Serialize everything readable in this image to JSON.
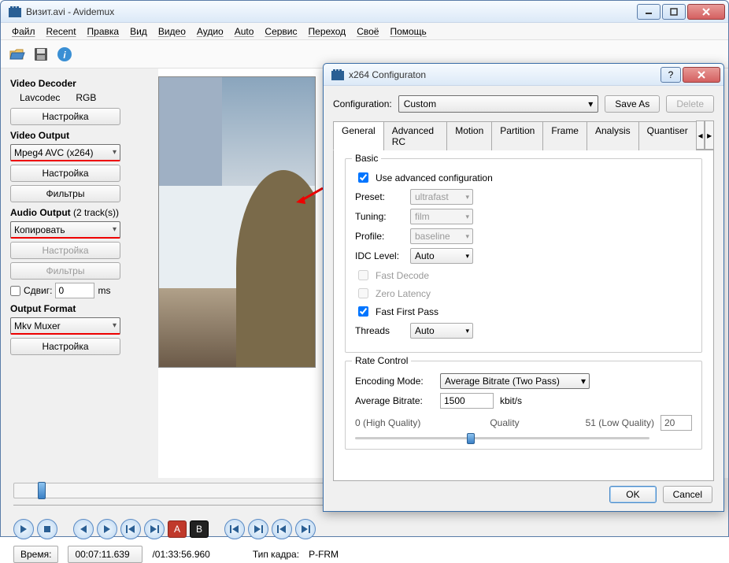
{
  "window": {
    "title": "Визит.avi - Avidemux"
  },
  "menu": [
    "Файл",
    "Recent",
    "Правка",
    "Вид",
    "Видео",
    "Аудио",
    "Auto",
    "Сервис",
    "Переход",
    "Своё",
    "Помощь"
  ],
  "sidebar": {
    "videoDecoder": {
      "title": "Video Decoder",
      "lav": "Lavcodec",
      "rgb": "RGB",
      "config": "Настройка"
    },
    "videoOutput": {
      "title": "Video Output",
      "codec": "Mpeg4 AVC (x264)",
      "config": "Настройка",
      "filters": "Фильтры"
    },
    "audioOutput": {
      "title": "Audio Output",
      "tracks": "(2 track(s))",
      "copy": "Копировать",
      "config": "Настройка",
      "filters": "Фильтры",
      "shift": "Сдвиг:",
      "shiftVal": "0",
      "shiftUnit": "ms"
    },
    "outputFormat": {
      "title": "Output Format",
      "muxer": "Mkv Muxer",
      "config": "Настройка"
    }
  },
  "status": {
    "timeLabel": "Время:",
    "time": "00:07:11.639",
    "total": "/01:33:56.960",
    "frameTypeLabel": "Тип кадра:",
    "frameType": "P-FRM"
  },
  "dialog": {
    "title": "x264 Configuraton",
    "configLabel": "Configuration:",
    "configValue": "Custom",
    "saveAs": "Save As",
    "delete": "Delete",
    "tabs": [
      "General",
      "Advanced RC",
      "Motion",
      "Partition",
      "Frame",
      "Analysis",
      "Quantiser"
    ],
    "basic": {
      "title": "Basic",
      "useAdv": "Use advanced configuration",
      "presetLabel": "Preset:",
      "preset": "ultrafast",
      "tuningLabel": "Tuning:",
      "tuning": "film",
      "profileLabel": "Profile:",
      "profile": "baseline",
      "idcLabel": "IDC Level:",
      "idc": "Auto",
      "fastDecode": "Fast Decode",
      "zeroLatency": "Zero Latency",
      "fastFirstPass": "Fast First Pass",
      "threadsLabel": "Threads",
      "threads": "Auto"
    },
    "rate": {
      "title": "Rate Control",
      "modeLabel": "Encoding Mode:",
      "mode": "Average Bitrate (Two Pass)",
      "avgLabel": "Average Bitrate:",
      "avgValue": "1500",
      "avgUnit": "kbit/s",
      "hq": "0 (High Quality)",
      "qualityLabel": "Quality",
      "lq": "51 (Low Quality)",
      "qspin": "20"
    },
    "ok": "OK",
    "cancel": "Cancel"
  }
}
